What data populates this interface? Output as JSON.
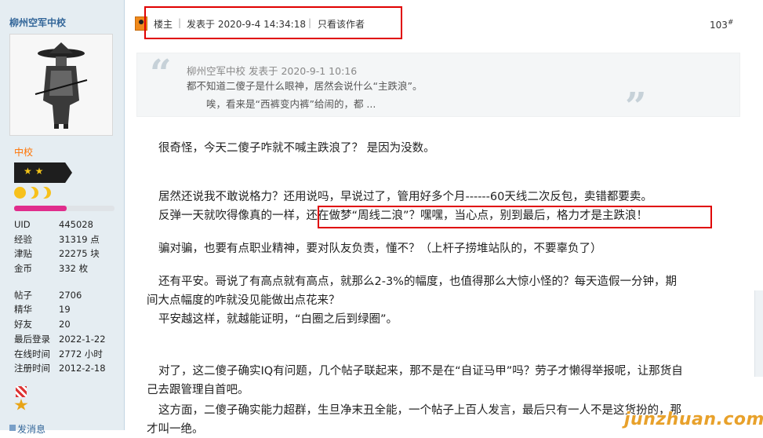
{
  "user": {
    "name": "柳州空军中校",
    "rank": "中校",
    "rank_stars": "★ ★",
    "progress_fraction": 0.52,
    "stats": [
      {
        "key": "UID",
        "value": "445028"
      },
      {
        "key": "经验",
        "value": "31319 点"
      },
      {
        "key": "津贴",
        "value": "22275 块"
      },
      {
        "key": "金币",
        "value": "332 枚"
      }
    ],
    "stats2": [
      {
        "key": "帖子",
        "value": "2706"
      },
      {
        "key": "精华",
        "value": "19"
      },
      {
        "key": "好友",
        "value": "20"
      },
      {
        "key": "最后登录",
        "value": "2022-1-22"
      },
      {
        "key": "在线时间",
        "value": "2772 小时"
      },
      {
        "key": "注册时间",
        "value": "2012-2-18"
      }
    ],
    "bottom_link": "发消息"
  },
  "post": {
    "author_label": "楼主",
    "posted_at": "发表于 2020-9-4 14:34:18",
    "only_author": "只看该作者",
    "floor": "103",
    "floor_suffix": "#"
  },
  "quote": {
    "meta": "柳州空军中校  发表于 2020-9-1 10:16",
    "line1": "都不知道二傻子是什么眼神，居然会说什么“主跌浪”。",
    "line2": "唉，看来是“西裤变内裤”给闹的，都 ..."
  },
  "body": {
    "p1": "很奇怪，今天二傻子咋就不喊主跌浪了？       是因为没数。",
    "p2": "居然还说我不敢说格力？还用说吗，早说过了，管用好多个月------60天线二次反包，卖错都要卖。",
    "p3a": "反弹一天就吹得像真的一样，",
    "p3b": "还在做梦“周线二浪”？嘿嘿，当心点，别到最后，格力才是主跌浪！",
    "p4": "骗对骗，也要有点职业精神，要对队友负责，懂不？（上杆子捞堆站队的，不要辜负了）",
    "p5a": "还有平安。哥说了有高点就有高点，就那么2-3%的幅度，也值得那么大惊小怪的？每天造假一分钟，期",
    "p5b": "间大点幅度的咋就没见能做出点花来？",
    "p6": "平安越这样，就越能证明，“白圈之后到绿圈”。",
    "p7a": "对了，这二傻子确实IQ有问题，几个帖子联起来，那不是在“自证马甲”吗？劳子才懒得举报呢，让那货自",
    "p7b": "己去跟管理自首吧。",
    "p8a": "这方面，二傻子确实能力超群，生旦净末丑全能，一个帖子上百人发言，最后只有一人不是这货扮的，那",
    "p8b": "才叫一绝。"
  },
  "watermark": "junzhuan.com",
  "colors": {
    "sidebar_bg": "#e5edf2",
    "highlight": "#e00000",
    "rank": "#ff7300",
    "link": "#336699"
  }
}
